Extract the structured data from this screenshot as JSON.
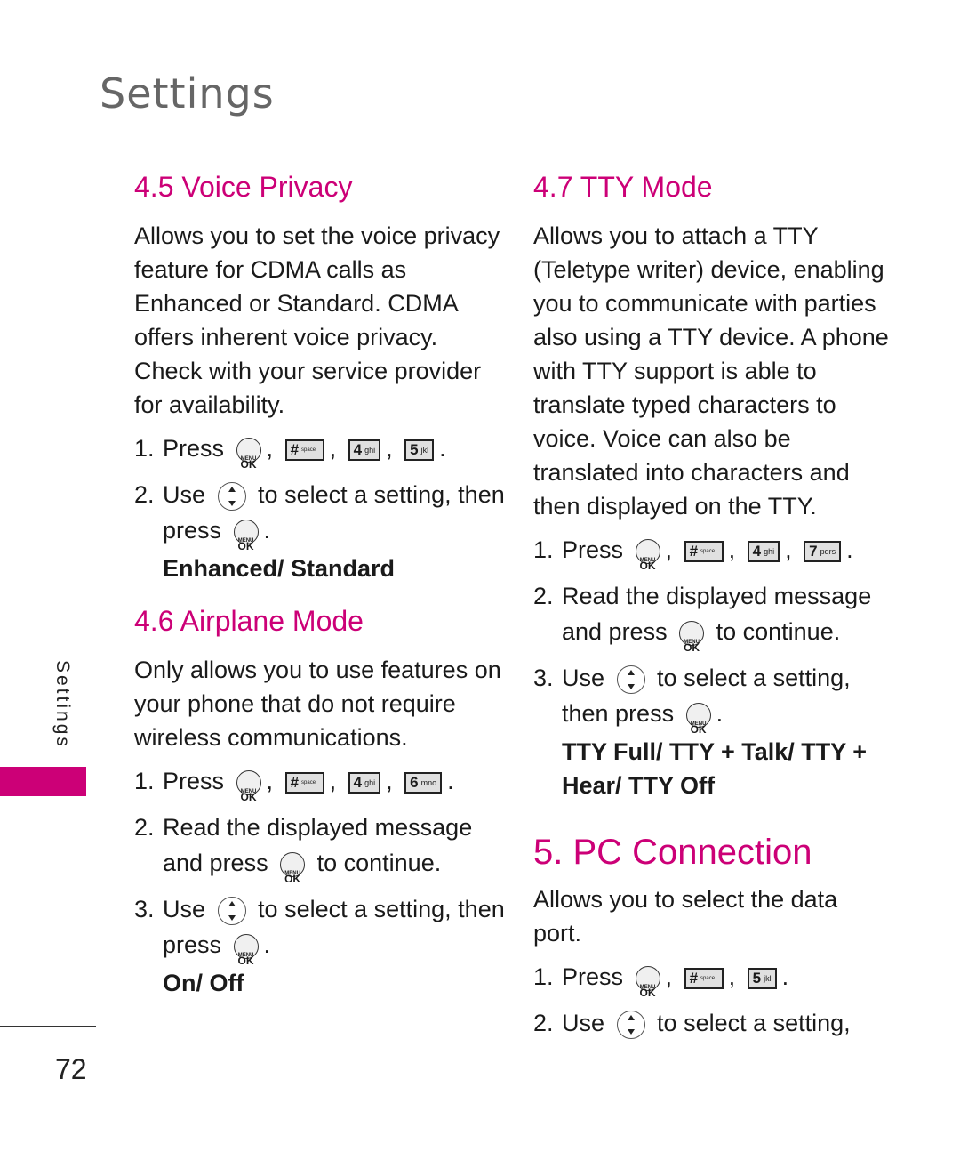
{
  "page": {
    "title": "Settings",
    "side_label": "Settings",
    "page_number": "72",
    "accent_color": "#cc0077"
  },
  "icons": {
    "menu_ok": "menu-ok-key",
    "nav": "up-down-navigation-key",
    "hash": "#",
    "hash_sub": "space",
    "key4": "4",
    "key4_sub": "ghi",
    "key5": "5",
    "key5_sub": "jkl",
    "key6": "6",
    "key6_sub": "mno",
    "key7": "7",
    "key7_sub": "pqrs"
  },
  "sections": {
    "voice_privacy": {
      "heading": "4.5 Voice Privacy",
      "body": "Allows you to set the voice privacy feature for CDMA calls as Enhanced or Standard. CDMA offers inherent voice privacy. Check with your service provider for availability.",
      "step1_num": "1.",
      "step1_text": "Press",
      "step2_num": "2.",
      "step2_a": "Use",
      "step2_b": "to select a setting, then press",
      "options": "Enhanced/ Standard"
    },
    "airplane_mode": {
      "heading": "4.6 Airplane Mode",
      "body": "Only allows you to use features on your phone that do not require wireless communications.",
      "step1_num": "1.",
      "step1_text": "Press",
      "step2_num": "2.",
      "step2_a": "Read the displayed message and press",
      "step2_b": "to continue.",
      "step3_num": "3.",
      "step3_a": "Use",
      "step3_b": "to select a setting, then press",
      "options": "On/ Off"
    },
    "tty_mode": {
      "heading": "4.7 TTY Mode",
      "body": "Allows you to attach a TTY (Teletype writer) device, enabling you to communicate with parties also using a TTY device. A phone with TTY support is able to translate typed characters to voice. Voice can also be translated into characters and then displayed on the TTY.",
      "step1_num": "1.",
      "step1_text": "Press",
      "step2_num": "2.",
      "step2_a": "Read the displayed message and press",
      "step2_b": "to continue.",
      "step3_num": "3.",
      "step3_a": "Use",
      "step3_b": "to select a setting, then press",
      "options": "TTY Full/ TTY + Talk/ TTY + Hear/ TTY Off"
    },
    "pc_connection": {
      "heading": "5. PC Connection",
      "body": "Allows you to select the data port.",
      "step1_num": "1.",
      "step1_text": "Press",
      "step2_num": "2.",
      "step2_a": "Use",
      "step2_b": "to select a setting,"
    }
  },
  "punct": {
    "comma": ",",
    "period": "."
  }
}
